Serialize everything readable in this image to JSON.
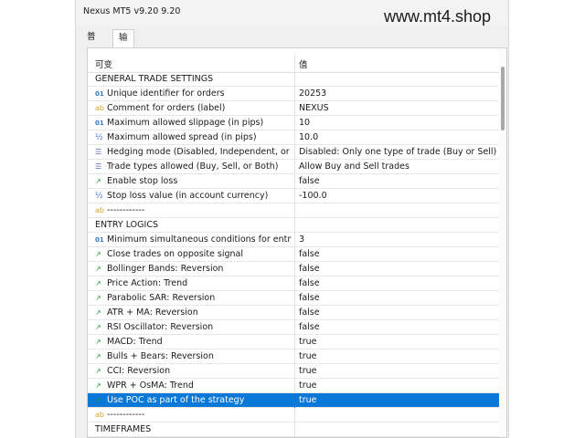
{
  "window": {
    "title": "Nexus MT5 v9.20 9.20"
  },
  "watermark": "www.mt4.shop",
  "tabs": [
    {
      "label": "普通"
    },
    {
      "label": "输入"
    }
  ],
  "table": {
    "headers": {
      "variable": "可变",
      "value": "值"
    },
    "rows": [
      {
        "icon": "",
        "name": "GENERAL TRADE SETTINGS",
        "value": ""
      },
      {
        "icon": "01",
        "name": "Unique identifier for orders",
        "value": "20253"
      },
      {
        "icon": "ab",
        "name": "Comment for orders (label)",
        "value": "NEXUS"
      },
      {
        "icon": "01",
        "name": "Maximum allowed slippage (in pips)",
        "value": "10"
      },
      {
        "icon": "½",
        "name": "Maximum allowed spread (in pips)",
        "value": "10.0"
      },
      {
        "icon": "☰",
        "name": "Hedging mode (Disabled, Independent, or ...",
        "value": "Disabled: Only one type of trade (Buy or Sell) a..."
      },
      {
        "icon": "☰",
        "name": "Trade types allowed (Buy, Sell, or Both)",
        "value": "Allow Buy and Sell trades"
      },
      {
        "icon": "↗",
        "name": "Enable stop loss",
        "value": "false"
      },
      {
        "icon": "½",
        "name": "Stop loss value (in account currency)",
        "value": "-100.0"
      },
      {
        "icon": "ab",
        "name": "------------",
        "value": ""
      },
      {
        "icon": "",
        "name": "ENTRY LOGICS",
        "value": ""
      },
      {
        "icon": "01",
        "name": "Minimum simultaneous conditions for entry",
        "value": "3"
      },
      {
        "icon": "↗",
        "name": "Close trades on opposite signal",
        "value": "false"
      },
      {
        "icon": "↗",
        "name": "Bollinger Bands: Reversion",
        "value": "false"
      },
      {
        "icon": "↗",
        "name": "Price Action: Trend",
        "value": "false"
      },
      {
        "icon": "↗",
        "name": "Parabolic SAR: Reversion",
        "value": "false"
      },
      {
        "icon": "↗",
        "name": "ATR + MA: Reversion",
        "value": "false"
      },
      {
        "icon": "↗",
        "name": "RSI Oscillator: Reversion",
        "value": "false"
      },
      {
        "icon": "↗",
        "name": "MACD: Trend",
        "value": "true"
      },
      {
        "icon": "↗",
        "name": "Bulls + Bears: Reversion",
        "value": "true"
      },
      {
        "icon": "↗",
        "name": "CCI: Reversion",
        "value": "true"
      },
      {
        "icon": "↗",
        "name": "WPR + OsMA: Trend",
        "value": "true"
      },
      {
        "icon": "↗",
        "name": "Use POC as part of the strategy",
        "value": "true"
      },
      {
        "icon": "ab",
        "name": "------------",
        "value": ""
      },
      {
        "icon": "",
        "name": "TIMEFRAMES",
        "value": ""
      }
    ]
  }
}
